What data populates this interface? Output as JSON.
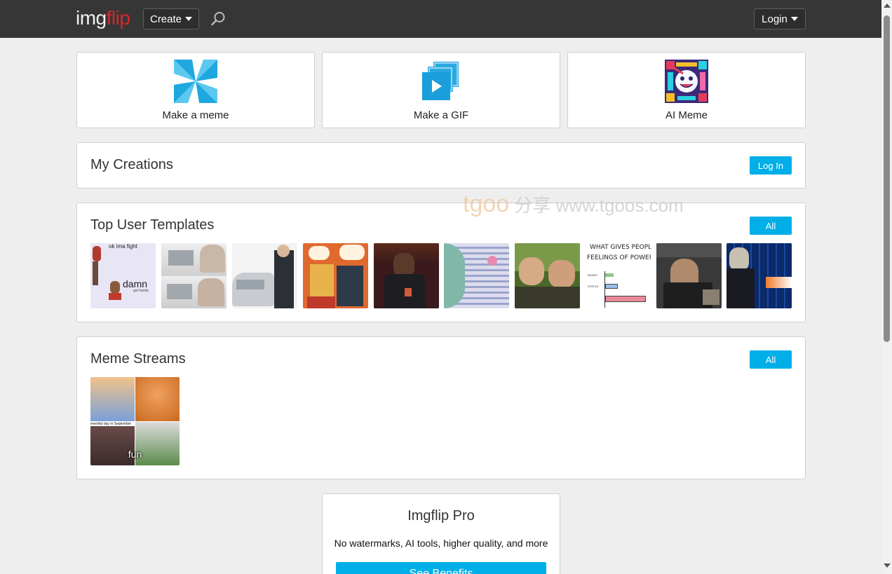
{
  "header": {
    "logo_part1": "img",
    "logo_part2": "flip",
    "create_label": "Create",
    "login_label": "Login",
    "search_icon": "magnifier-icon"
  },
  "tiles": [
    {
      "label": "Make a meme",
      "icon": "pinwheel-icon"
    },
    {
      "label": "Make a GIF",
      "icon": "gif-stack-icon"
    },
    {
      "label": "AI Meme",
      "icon": "ai-face-icon"
    }
  ],
  "creations": {
    "title": "My Creations",
    "button": "Log In"
  },
  "templates": {
    "title": "Top User Templates",
    "button": "All",
    "items": [
      {
        "caption_top": "ok ima fight",
        "caption_bottom": "damn",
        "caption_small": "got hands"
      },
      {
        "caption_top": "",
        "caption_bottom": "",
        "caption_small": ""
      },
      {
        "caption_top": "",
        "caption_bottom": "",
        "caption_small": ""
      },
      {
        "caption_top": "",
        "caption_bottom": "",
        "caption_small": ""
      },
      {
        "caption_top": "",
        "caption_bottom": "",
        "caption_small": ""
      },
      {
        "caption_top": "",
        "caption_bottom": "",
        "caption_small": ""
      },
      {
        "caption_top": "",
        "caption_bottom": "",
        "caption_small": ""
      },
      {
        "caption_top": "WHAT GIVES PEOPLE",
        "caption_bottom": "FEELINGS OF POWER",
        "caption_small": "MONEY",
        "caption_small2": "STATUS"
      },
      {
        "caption_top": "",
        "caption_bottom": "",
        "caption_small": ""
      },
      {
        "caption_top": "",
        "caption_bottom": "",
        "caption_small": ""
      }
    ]
  },
  "streams": {
    "title": "Meme Streams",
    "button": "All",
    "items": [
      {
        "caption": "fun",
        "tiny_text": "eventful day in September"
      }
    ]
  },
  "pro": {
    "title": "Imgflip Pro",
    "text": "No watermarks, AI tools, higher quality, and more",
    "button": "See Benefits"
  },
  "watermark": {
    "text1": "tgoo",
    "text2": "分享 www.tgoos.com"
  },
  "colors": {
    "accent": "#00aee8",
    "header_bg": "#363636",
    "logo_red": "#d8262b"
  }
}
